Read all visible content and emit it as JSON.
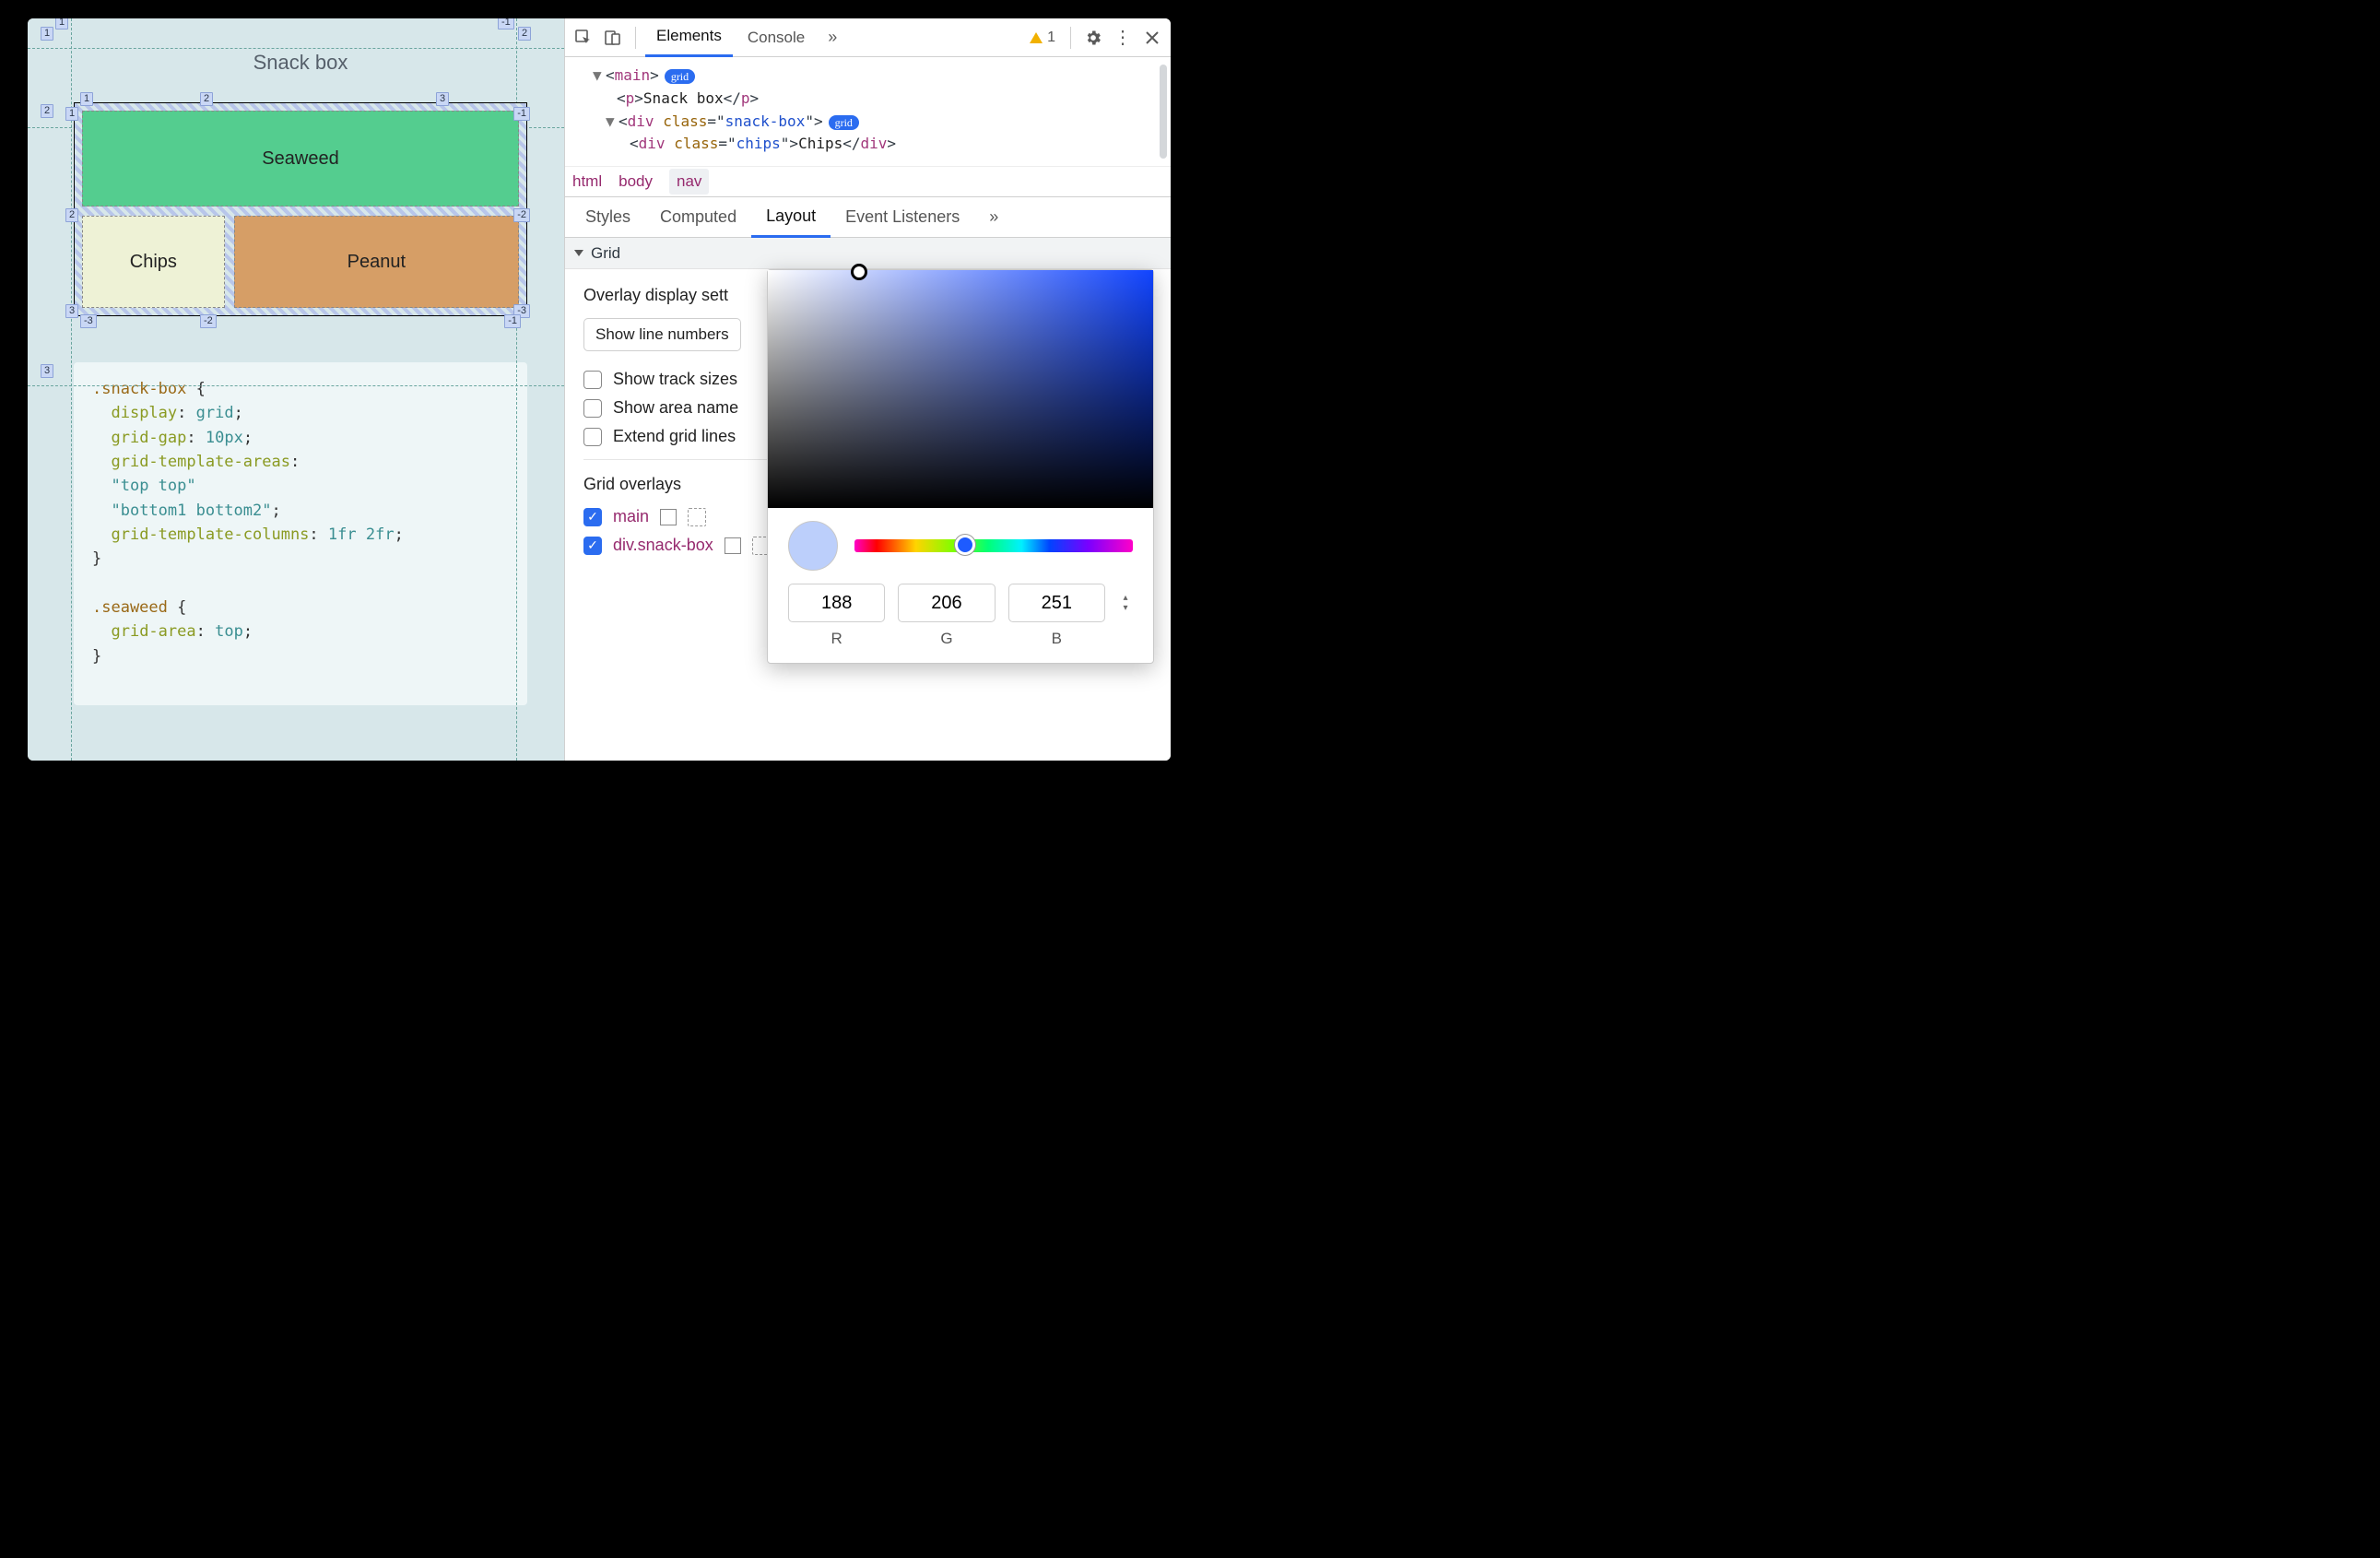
{
  "page": {
    "title": "Snack box",
    "cells": {
      "seaweed": "Seaweed",
      "chips": "Chips",
      "peanut": "Peanut"
    },
    "grid_inner": {
      "top": {
        "c1": "1",
        "c2": "2",
        "c3": "3"
      },
      "left": {
        "r1": "1",
        "r2": "2",
        "r3": "3"
      },
      "right": {
        "r1": "-1",
        "r2": "-2",
        "r3": "-3"
      },
      "bottom": {
        "c1": "-3",
        "c2": "-2",
        "c3": "-1"
      }
    },
    "grid_outer": {
      "top": {
        "c1": "1",
        "c2": "-1"
      },
      "left": {
        "r1": "1",
        "r2": "2",
        "r3": "3"
      },
      "right": {
        "r2": "2"
      }
    }
  },
  "css_code": {
    "sel1": ".snack-box",
    "rules1": [
      {
        "prop": "display",
        "val": "grid"
      },
      {
        "prop": "grid-gap",
        "val": "10px"
      },
      {
        "prop": "grid-template-areas",
        "val": ""
      },
      {
        "lit": "\"top top\""
      },
      {
        "lit": "\"bottom1 bottom2\"",
        "term": ";"
      },
      {
        "prop": "grid-template-columns",
        "val": "1fr 2fr"
      }
    ],
    "sel2": ".seaweed",
    "rules2": [
      {
        "prop": "grid-area",
        "val": "top"
      }
    ]
  },
  "devtools": {
    "tabs": {
      "elements": "Elements",
      "console": "Console"
    },
    "warn_count": "1",
    "dom": {
      "l1_tag": "main",
      "l1_pill": "grid",
      "l2_tag": "p",
      "l2_text": "Snack box",
      "l3_tag": "div",
      "l3_attr": "class",
      "l3_attrval": "snack-box",
      "l3_pill": "grid",
      "l4_tag": "div",
      "l4_attr": "class",
      "l4_attrval": "chips",
      "l4_text": "Chips"
    },
    "crumbs": {
      "html": "html",
      "body": "body",
      "nav": "nav"
    },
    "subtabs": {
      "styles": "Styles",
      "computed": "Computed",
      "layout": "Layout",
      "events": "Event Listeners"
    },
    "section": "Grid",
    "overlay_heading": "Overlay display sett",
    "dropdown": "Show line numbers",
    "checks": {
      "tracks": "Show track sizes",
      "areas": "Show area name",
      "extend": "Extend grid lines"
    },
    "overlays_heading": "Grid overlays",
    "ov1": {
      "label": "main",
      "swatch": "#6bb6a8"
    },
    "ov2": {
      "label": "div.snack-box"
    }
  },
  "picker": {
    "r": "188",
    "g": "206",
    "b": "251",
    "lr": "R",
    "lg": "G",
    "lb": "B",
    "swatch": "#bccffb"
  }
}
